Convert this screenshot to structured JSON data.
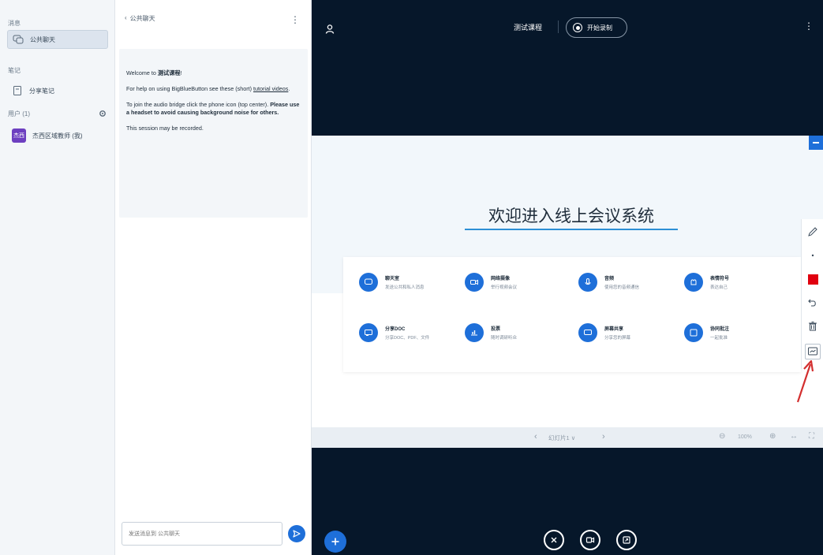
{
  "userlist": {
    "messages_label": "消息",
    "public_chat": "公共聊天",
    "notes_label": "笔记",
    "shared_notes": "分享笔记",
    "users_label": "用户 (1)",
    "user_name": "杰西区域教师 (我)",
    "user_avatar": "杰西"
  },
  "chat": {
    "title": "公共聊天",
    "welcome_prefix": "Welcome to ",
    "welcome_course": "测试课程",
    "welcome_suffix": "!",
    "help_prefix": "For help on using BigBlueButton see these (short) ",
    "help_link": "tutorial videos",
    "help_suffix": ".",
    "audio_prefix": "To join the audio bridge click the phone icon (top center). ",
    "audio_bold": "Please use a headset to avoid causing background noise for others.",
    "recorded": "This session may be recorded.",
    "input_placeholder": "发送消息到 公共聊天"
  },
  "stage": {
    "course_title": "测试课程",
    "record_label": "开始录制"
  },
  "slide": {
    "title": "欢迎进入线上会议系统",
    "features": [
      {
        "icon": "chat-icon",
        "title": "聊天室",
        "desc": "发送公共和私人消息"
      },
      {
        "icon": "video-icon",
        "title": "网络摄像",
        "desc": "举行视频会议"
      },
      {
        "icon": "microphone-icon",
        "title": "音频",
        "desc": "使用您的音频通信"
      },
      {
        "icon": "emoji-icon",
        "title": "表情符号",
        "desc": "表达自己"
      },
      {
        "icon": "share-icon",
        "title": "分享DOC",
        "desc": "分享DOC、PDF、文件"
      },
      {
        "icon": "poll-icon",
        "title": "投票",
        "desc": "随时调研听众"
      },
      {
        "icon": "screen-share-icon",
        "title": "屏幕共享",
        "desc": "分享您的屏幕"
      },
      {
        "icon": "collaborate-icon",
        "title": "协同批注",
        "desc": "一起批准"
      }
    ]
  },
  "nav": {
    "slide_select": "幻灯片1 ∨",
    "zoom_level": "100%"
  },
  "colors": {
    "accent": "#1e6fd9",
    "stage_bg": "#06172a",
    "pen_color": "#e0000f",
    "arrow": "#d32f2f"
  }
}
